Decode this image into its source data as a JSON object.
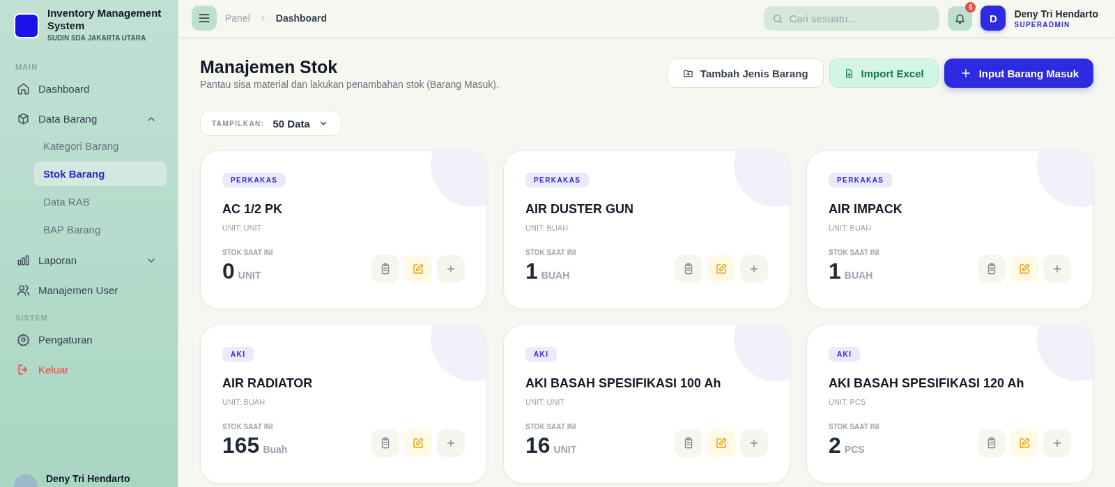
{
  "sidebar": {
    "brand": {
      "title": "Inventory Management System",
      "subtitle": "SUDIN SDA JAKARTA UTARA"
    },
    "sections": [
      {
        "label": "MAIN",
        "items": [
          {
            "label": "Dashboard",
            "kind": "link"
          },
          {
            "label": "Data Barang",
            "kind": "group",
            "expanded": true,
            "children": [
              {
                "label": "Kategori Barang",
                "selected": false
              },
              {
                "label": "Stok Barang",
                "selected": true
              },
              {
                "label": "Data RAB",
                "selected": false
              },
              {
                "label": "BAP Barang",
                "selected": false
              }
            ]
          },
          {
            "label": "Laporan",
            "kind": "group",
            "expanded": false
          },
          {
            "label": "Manajemen User",
            "kind": "link"
          }
        ]
      },
      {
        "label": "SISTEM",
        "items": [
          {
            "label": "Pengaturan",
            "kind": "link"
          },
          {
            "label": "Keluar",
            "kind": "logout"
          }
        ]
      }
    ],
    "footer_user": {
      "name": "Deny Tri Hendarto"
    }
  },
  "topbar": {
    "breadcrumb": [
      "Panel",
      "Dashboard"
    ],
    "search": {
      "placeholder": "Cari sesuatu..."
    },
    "notification_count": "6",
    "user": {
      "initial": "D",
      "name": "Deny Tri Hendarto",
      "role": "SUPERADMIN"
    }
  },
  "page": {
    "title": "Manajemen Stok",
    "subtitle": "Pantau sisa material dan lakukan penambahan stok (Barang Masuk).",
    "actions": [
      {
        "label": "Tambah Jenis Barang",
        "kind": "secondary"
      },
      {
        "label": "Import Excel",
        "kind": "success"
      },
      {
        "label": "Input Barang Masuk",
        "kind": "primary"
      }
    ],
    "page_size": {
      "label": "TAMPILKAN:",
      "value": "50 Data"
    }
  },
  "cards": [
    {
      "category": "PERKAKAS",
      "name": "AC 1/2 PK",
      "unit": "UNIT: UNIT",
      "stock_label": "STOK SAAT INI",
      "stock": "0",
      "stock_unit": "UNIT"
    },
    {
      "category": "PERKAKAS",
      "name": "AIR DUSTER GUN",
      "unit": "UNIT: BUAH",
      "stock_label": "STOK SAAT INI",
      "stock": "1",
      "stock_unit": "BUAH"
    },
    {
      "category": "PERKAKAS",
      "name": "AIR IMPACK",
      "unit": "UNIT: BUAH",
      "stock_label": "STOK SAAT INI",
      "stock": "1",
      "stock_unit": "BUAH"
    },
    {
      "category": "AKI",
      "name": "AIR RADIATOR",
      "unit": "UNIT: BUAH",
      "stock_label": "STOK SAAT INI",
      "stock": "165",
      "stock_unit": "Buah"
    },
    {
      "category": "AKI",
      "name": "AKI BASAH SPESIFIKASI 100 Ah",
      "unit": "UNIT: UNIT",
      "stock_label": "STOK SAAT INI",
      "stock": "16",
      "stock_unit": "UNIT"
    },
    {
      "category": "AKI",
      "name": "AKI BASAH SPESIFIKASI 120 Ah",
      "unit": "UNIT: PCS",
      "stock_label": "STOK SAAT INI",
      "stock": "2",
      "stock_unit": "PCS"
    }
  ]
}
